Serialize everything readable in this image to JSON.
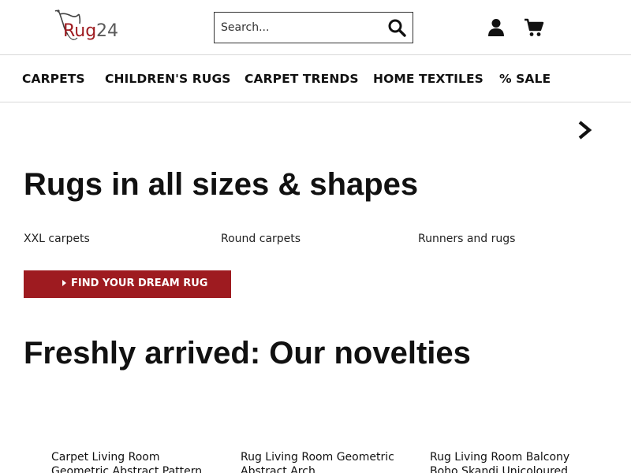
{
  "header": {
    "logo": {
      "brand": "Rug",
      "number": "24",
      "brand_color": "#9e1b20"
    },
    "search": {
      "placeholder": "Search...",
      "value": ""
    },
    "icons": {
      "search": "search-icon",
      "account": "user-icon",
      "cart": "cart-icon"
    }
  },
  "nav": {
    "items": [
      {
        "label": "CARPETS"
      },
      {
        "label": "CHILDREN'S RUGS"
      },
      {
        "label": "CARPET TRENDS"
      },
      {
        "label": "HOME TEXTILES"
      },
      {
        "label": "% SALE"
      }
    ]
  },
  "slider": {
    "next_icon": "chevron-right-icon"
  },
  "hero": {
    "title": "Rugs in all sizes & shapes",
    "links": [
      {
        "label": "XXL carpets"
      },
      {
        "label": "Round carpets"
      },
      {
        "label": "Runners and rugs"
      }
    ],
    "cta_label": "FIND YOUR DREAM RUG",
    "accent_color": "#9e1b20"
  },
  "novelties": {
    "title": "Freshly arrived: Our novelties",
    "products": [
      {
        "title": "Carpet Living Room Geometric Abstract Pattern"
      },
      {
        "title": "Rug Living Room Geometric Abstract Arch"
      },
      {
        "title": "Rug Living Room Balcony Boho Skandi Unicoloured"
      }
    ]
  }
}
